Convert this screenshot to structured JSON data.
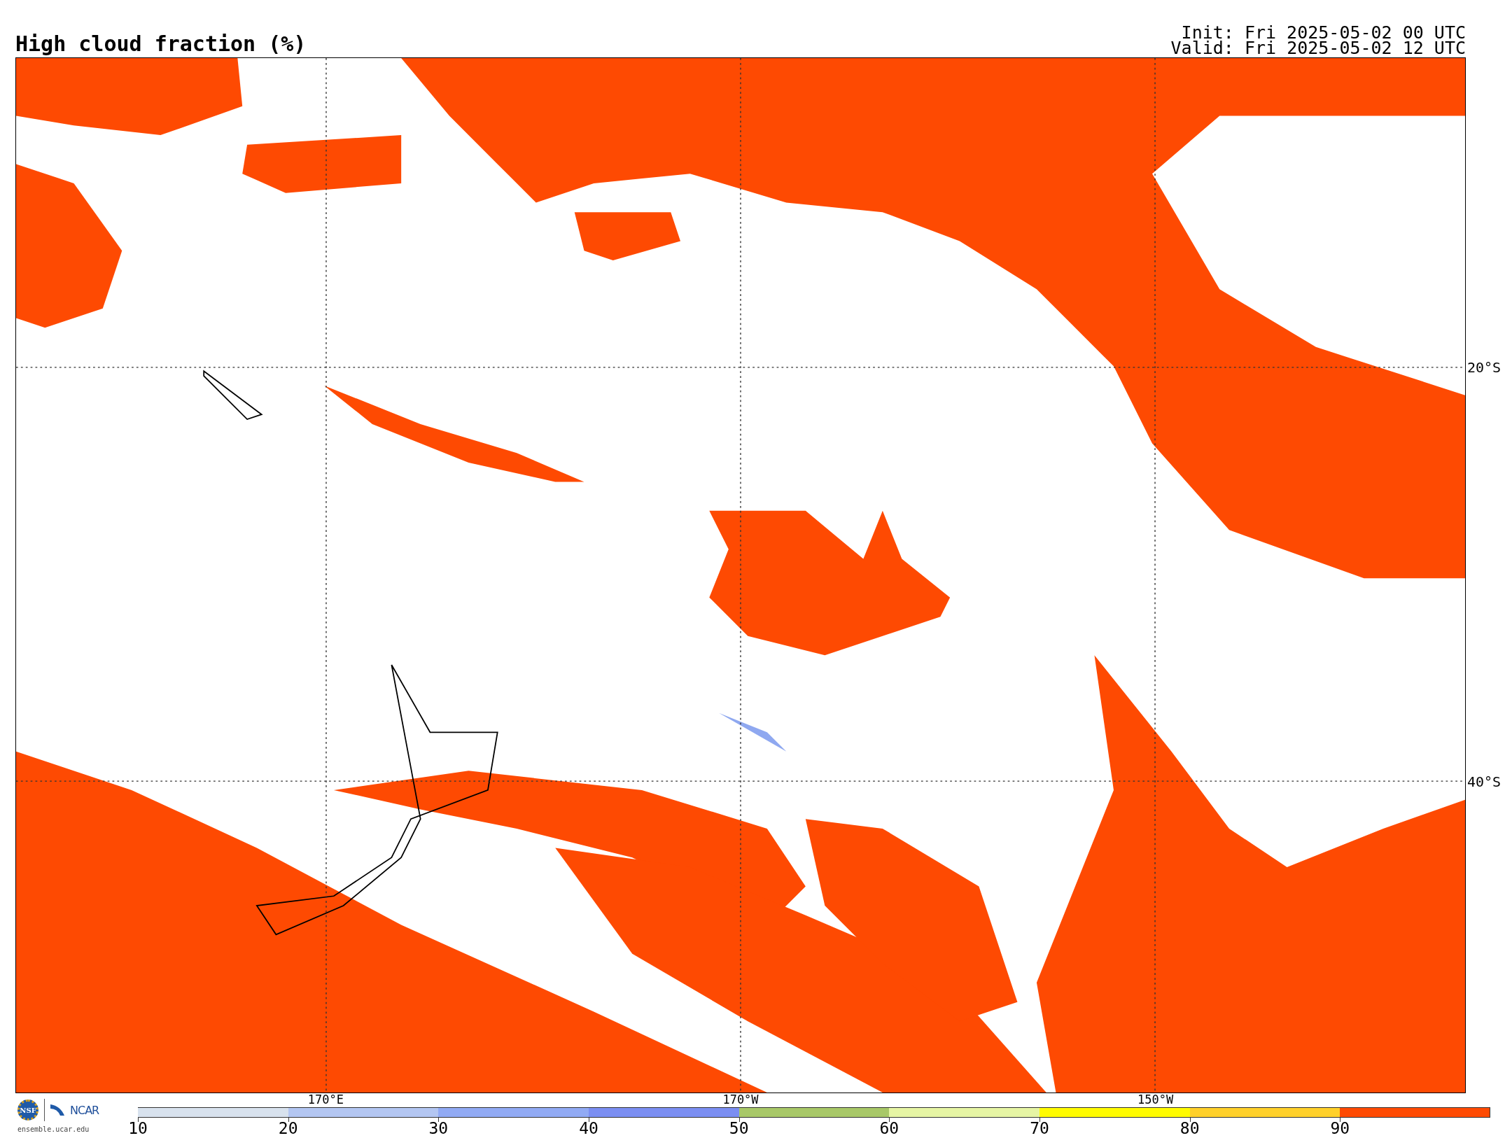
{
  "title": "High cloud fraction (%)",
  "init": "Init: Fri 2025-05-02 00 UTC",
  "valid": "Valid: Fri 2025-05-02 12 UTC",
  "map": {
    "lat_labels": [
      "20°S",
      "40°S"
    ],
    "lon_labels": [
      "170°E",
      "170°W",
      "150°W"
    ]
  },
  "logo": {
    "seal": "NSF",
    "name": "NCAR",
    "url": "ensemble.ucar.edu"
  },
  "colorbar": {
    "segments": [
      {
        "color": "#d8e2ee",
        "tick": "10"
      },
      {
        "color": "#b3c6f2",
        "tick": "20"
      },
      {
        "color": "#91aaf4",
        "tick": "30"
      },
      {
        "color": "#7b8ef2",
        "tick": "40"
      },
      {
        "color": "#a8c868",
        "tick": "50"
      },
      {
        "color": "#e6f5a4",
        "tick": "60"
      },
      {
        "color": "#fffb00",
        "tick": "70"
      },
      {
        "color": "#ffd02a",
        "tick": "80"
      },
      {
        "color": "#fe4a02",
        "tick": "90"
      }
    ]
  }
}
